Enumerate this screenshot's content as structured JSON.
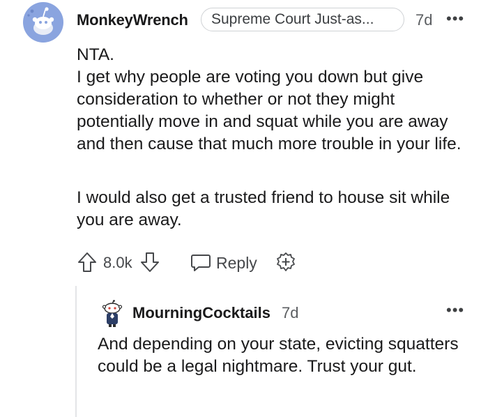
{
  "comment": {
    "username": "MonkeyWrench",
    "flair": "Supreme Court Just-as...",
    "age": "7d",
    "more": "•••",
    "paragraph1": "NTA.\nI get why people are voting you down but give consideration to whether or not they might potentially move in and squat while you are away and then cause that much more trouble in your life.",
    "paragraph2": "I would also get a trusted friend to house sit while you are away.",
    "actions": {
      "score": "8.0k",
      "reply_label": "Reply"
    },
    "avatar_color": "#8aa4df"
  },
  "reply": {
    "username": "MourningCocktails",
    "age": "7d",
    "more": "•••",
    "text": "And depending on your state, evicting squatters could be a legal nightmare. Trust your gut."
  }
}
